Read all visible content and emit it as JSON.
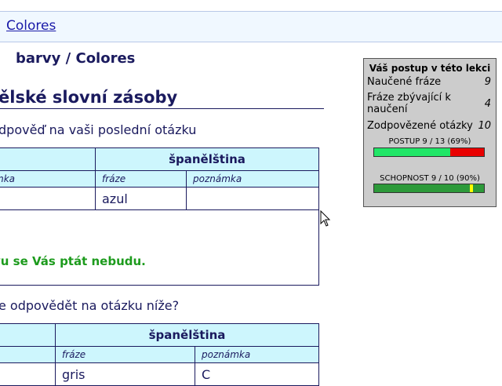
{
  "breadcrumb": {
    "link": "Colores"
  },
  "lesson_title": "barvy / Colores",
  "section_title": "ělské slovní zásoby",
  "answer_heading": "dpověď na vaši poslední otázku",
  "question_heading": "e odpovědět na otázku níže?",
  "answer_table": {
    "language_header": "španělština",
    "col_phrase": "fráze",
    "col_note": "poznámka",
    "left_sub": "mka",
    "phrase_value": "azul",
    "note_value": ""
  },
  "result_message": "vu se Vás ptát nebudu.",
  "question_table": {
    "language_header": "španělština",
    "col_phrase": "fráze",
    "col_note": "poznámka",
    "phrase_value": "gris",
    "note_value": "C"
  },
  "progress_panel": {
    "title": "Váš postup v této lekci",
    "learned_label": "Naučené fráze",
    "learned_value": "9",
    "remaining_label": "Fráze zbývající k naučení",
    "remaining_value": "4",
    "answered_label": "Zodpovězené otázky",
    "answered_value": "10",
    "progress_label": "POSTUP 9 / 13 (69%)",
    "progress_fraction": 0.69,
    "skill_label": "SCHOPNOST 9 / 10 (90%)",
    "skill_fraction": 0.9
  },
  "colors": {
    "accent": "#1a1a5e",
    "header_bg": "#cdf6fd",
    "success": "#1d9b1d",
    "bar_good": "#21e667",
    "bar_bad": "#e80000"
  }
}
